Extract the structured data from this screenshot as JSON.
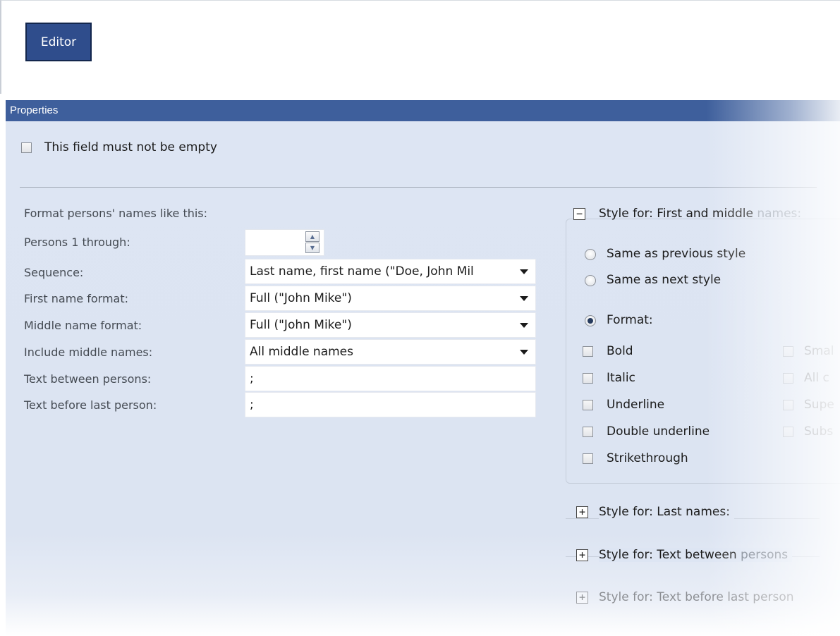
{
  "topbar": {
    "editor_button": "Editor"
  },
  "properties": {
    "header": "Properties",
    "must_not_be_empty": {
      "label": "This field must not be empty",
      "checked": false
    },
    "format_intro": "Format persons' names like this:",
    "rows": {
      "persons_through": {
        "label": "Persons 1 through:",
        "value": ""
      },
      "sequence": {
        "label": "Sequence:",
        "value": "Last name, first name (\"Doe, John Mil"
      },
      "first_name_format": {
        "label": "First name format:",
        "value": "Full (\"John Mike\")"
      },
      "middle_name_format": {
        "label": "Middle name format:",
        "value": "Full (\"John Mike\")"
      },
      "include_middle": {
        "label": "Include middle names:",
        "value": "All middle names"
      },
      "text_between": {
        "label": "Text between persons:",
        "value": ";"
      },
      "text_before_last": {
        "label": "Text before last person:",
        "value": ";"
      }
    }
  },
  "style_first_middle": {
    "title_a": "Style for: First and middle",
    "title_b": "names:",
    "toggle": "−",
    "same_previous": "Same as previous style",
    "same_next": "Same as next style",
    "format": "Format:",
    "selected_option": "format",
    "options_left": [
      "Bold",
      "Italic",
      "Underline",
      "Double underline",
      "Strikethrough"
    ],
    "options_right": [
      "Smal",
      "All c",
      "Supe",
      "Subs"
    ]
  },
  "collapsed_sections": [
    {
      "toggle": "+",
      "title_a": "Style for: Last names:",
      "title_b": ""
    },
    {
      "toggle": "+",
      "title_a": "Style for: Text between",
      "title_b": "persons"
    },
    {
      "toggle": "+",
      "title_a": "Style for: Text before last person",
      "title_b": ""
    }
  ],
  "colors": {
    "header": "#3e5f9c",
    "panel": "#dde5f3",
    "editor_button": "#2f4d8c"
  }
}
